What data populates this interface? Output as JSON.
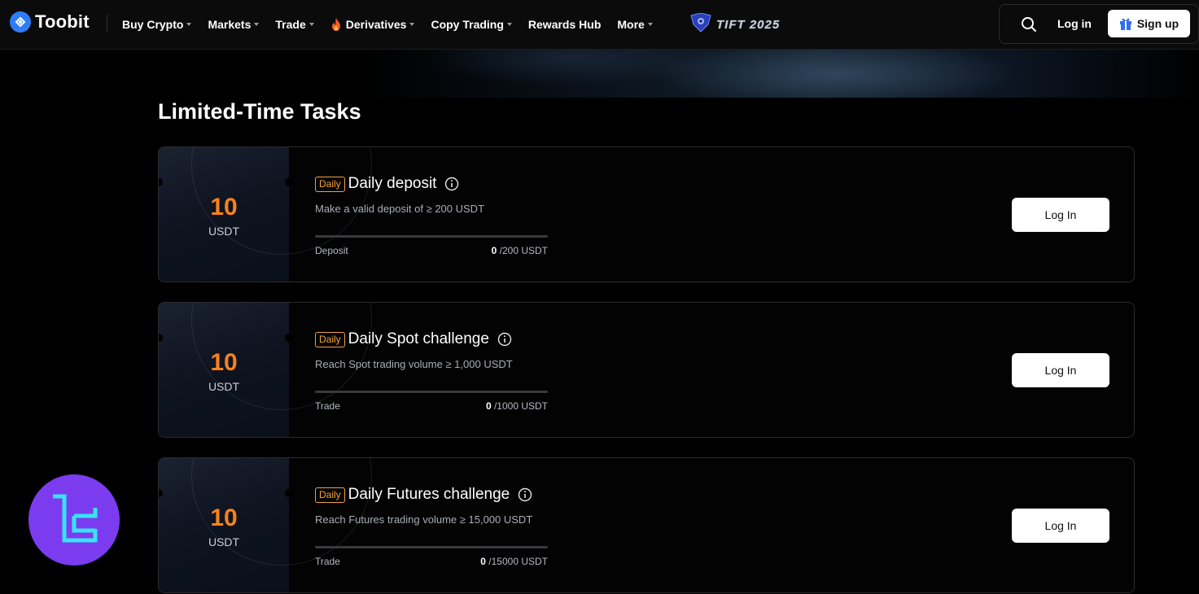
{
  "brand": {
    "name": "Toobit"
  },
  "nav": {
    "items": [
      {
        "label": "Buy Crypto",
        "has_caret": true
      },
      {
        "label": "Markets",
        "has_caret": true
      },
      {
        "label": "Trade",
        "has_caret": true
      },
      {
        "label": "Derivatives",
        "has_caret": true,
        "icon": "fire-icon"
      },
      {
        "label": "Copy Trading",
        "has_caret": true
      },
      {
        "label": "Rewards Hub",
        "has_caret": false
      },
      {
        "label": "More",
        "has_caret": true
      }
    ],
    "event_badge": "TIFT 2025",
    "login_label": "Log in",
    "signup_label": "Sign up"
  },
  "section": {
    "title": "Limited-Time Tasks"
  },
  "tasks": [
    {
      "badge": "Daily",
      "title": "Daily deposit",
      "description": "Make a valid deposit of ≥ 200 USDT",
      "reward_amount": "10",
      "reward_unit": "USDT",
      "progress_label": "Deposit",
      "progress_current": "0",
      "progress_target": " /200 USDT",
      "progress_fraction": 0,
      "button_label": "Log In"
    },
    {
      "badge": "Daily",
      "title": "Daily Spot challenge",
      "description": "Reach Spot trading volume ≥ 1,000 USDT",
      "reward_amount": "10",
      "reward_unit": "USDT",
      "progress_label": "Trade",
      "progress_current": "0",
      "progress_target": " /1000 USDT",
      "progress_fraction": 0,
      "button_label": "Log In"
    },
    {
      "badge": "Daily",
      "title": "Daily Futures challenge",
      "description": "Reach Futures trading volume ≥ 15,000 USDT",
      "reward_amount": "10",
      "reward_unit": "USDT",
      "progress_label": "Trade",
      "progress_current": "0",
      "progress_target": " /15000 USDT",
      "progress_fraction": 0,
      "button_label": "Log In"
    }
  ],
  "colors": {
    "accent_orange": "#f7811f",
    "brand_blue": "#2f7cf6",
    "badge_border": "#f0a040",
    "watermark_purple": "#7b3cf0"
  }
}
